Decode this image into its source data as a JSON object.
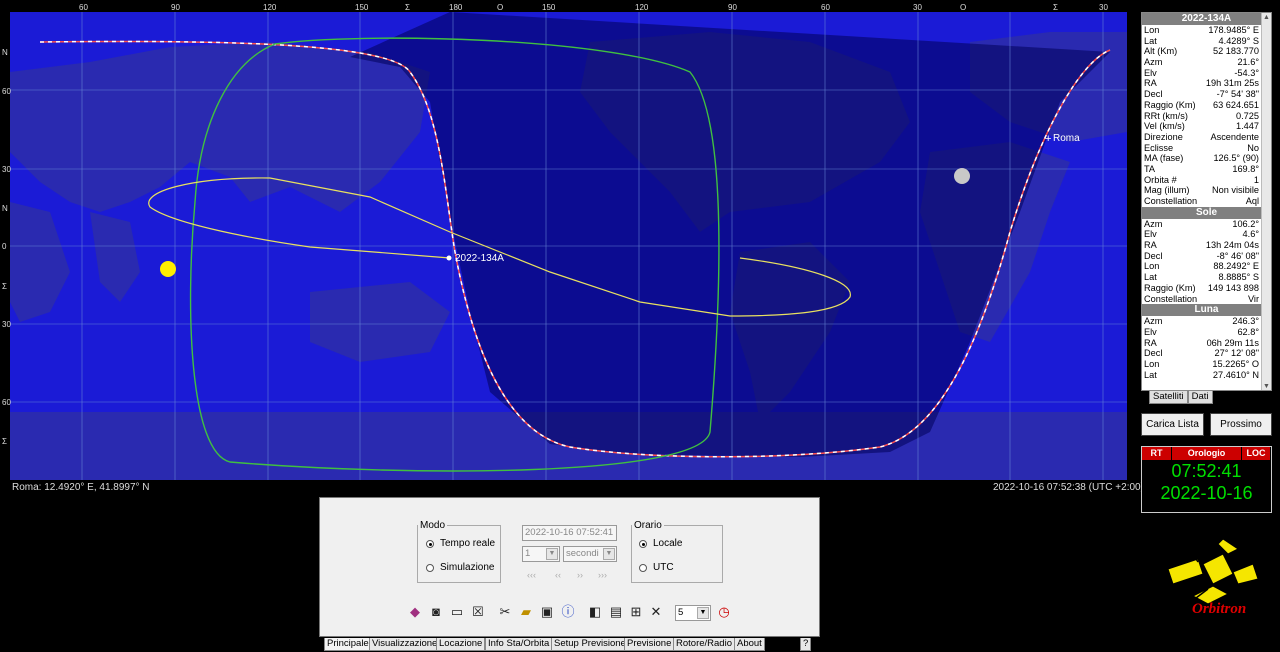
{
  "map": {
    "top_ticks": [
      "60",
      "90",
      "120",
      "150",
      "Σ",
      "180",
      "Ο",
      "150",
      "120",
      "90",
      "60",
      "30",
      "Ο",
      "Σ",
      "30"
    ],
    "left_ticks": [
      "Ν",
      "60",
      "30",
      "Ν",
      "0",
      "Σ",
      "30",
      "60",
      "Σ"
    ],
    "sat_label": "2022-134A",
    "city_label": "Roma",
    "colors": {
      "ocean": "#1b1bd6",
      "land": "#2c2ca0",
      "night": "#00005a",
      "track": "#e8e060",
      "footprint": "#40c040"
    }
  },
  "status": {
    "location": "Roma: 12.4920° E, 41.8997° N",
    "datetime": "2022-10-16 07:52:38 (UTC +2:00)"
  },
  "info": {
    "sat_title": "2022-134A",
    "sat_rows": [
      [
        "Lon",
        "178.9485° E"
      ],
      [
        "Lat",
        "4.4289° S"
      ],
      [
        "Alt (Km)",
        "52 183.770"
      ],
      [
        "Azm",
        "21.6°"
      ],
      [
        "Elv",
        "-54.3°"
      ],
      [
        "RA",
        "19h 31m 25s"
      ],
      [
        "Decl",
        "-7° 54' 38\""
      ],
      [
        "Raggio (Km)",
        "63 624.651"
      ],
      [
        "RRt (km/s)",
        "0.725"
      ],
      [
        "Vel (km/s)",
        "1.447"
      ],
      [
        "Direzione",
        "Ascendente"
      ],
      [
        "Eclisse",
        "No"
      ],
      [
        "MA (fase)",
        "126.5° (90)"
      ],
      [
        "TA",
        "169.8°"
      ],
      [
        "Orbita #",
        "1"
      ],
      [
        "Mag (illum)",
        "Non visibile"
      ],
      [
        "Constellation",
        "Aql"
      ]
    ],
    "sun_title": "Sole",
    "sun_rows": [
      [
        "Azm",
        "106.2°"
      ],
      [
        "Elv",
        "4.6°"
      ],
      [
        "RA",
        "13h 24m 04s"
      ],
      [
        "Decl",
        "-8° 46' 08\""
      ],
      [
        "Lon",
        "88.2492° E"
      ],
      [
        "Lat",
        "8.8885° S"
      ],
      [
        "Raggio (Km)",
        "149 143 898"
      ],
      [
        "Constellation",
        "Vir"
      ]
    ],
    "moon_title": "Luna",
    "moon_rows": [
      [
        "Azm",
        "246.3°"
      ],
      [
        "Elv",
        "62.8°"
      ],
      [
        "RA",
        "06h 29m 11s"
      ],
      [
        "Decl",
        "27° 12' 08\""
      ],
      [
        "Lon",
        "15.2265° O"
      ],
      [
        "Lat",
        "27.4610° N"
      ]
    ],
    "tabs": [
      "Satelliti",
      "Dati"
    ]
  },
  "buttons": {
    "carica": "Carica Lista",
    "prossimo": "Prossimo"
  },
  "clock": {
    "rt": "RT",
    "orologio": "Orologio",
    "loc": "LOC",
    "time": "07:52:41",
    "date": "2022-10-16"
  },
  "logo": {
    "text": "Orbitron"
  },
  "panel": {
    "modo_legend": "Modo",
    "tempo_reale": "Tempo reale",
    "simulazione": "Simulazione",
    "datetime_value": "2022-10-16 07:52:41",
    "step_value": "1",
    "unit_value": "secondi",
    "nav_symbols": [
      "‹‹‹",
      "‹‹",
      "››",
      "›››"
    ],
    "orario_legend": "Orario",
    "locale": "Locale",
    "utc": "UTC",
    "count_value": "5"
  },
  "bottom_tabs": [
    "Principale",
    "Visualizzazione",
    "Locazione",
    "Info Sta/Orbita",
    "Setup Previsione",
    "Previsione",
    "Rotore/Radio",
    "About",
    "?"
  ]
}
